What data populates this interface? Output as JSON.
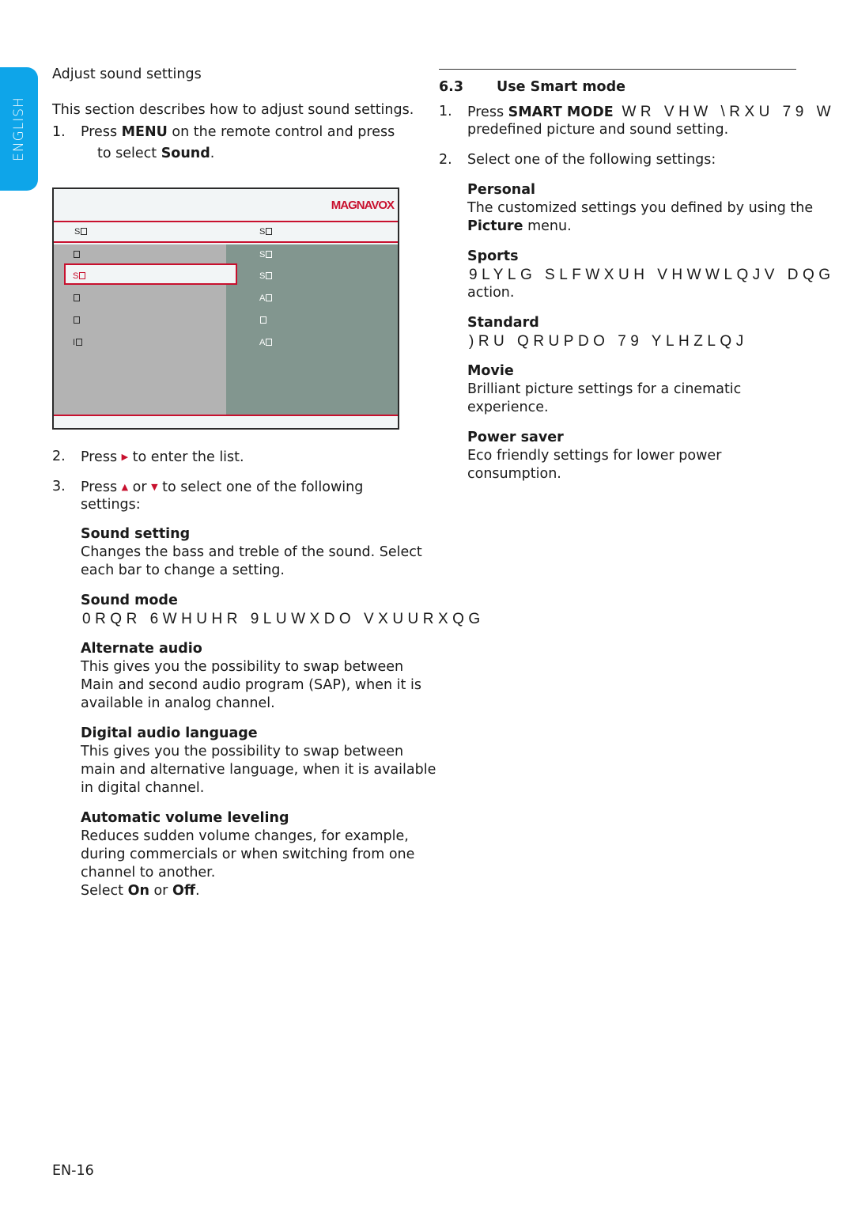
{
  "side_tab": {
    "label": "ENGLISH",
    "color": "#0ea5e9"
  },
  "left": {
    "heading": "Adjust sound settings",
    "intro": "This section describes how to adjust sound settings.",
    "step1": {
      "num": "1.",
      "pre": "Press ",
      "key": "MENU",
      "post": " on the remote control and press",
      "line2_pre": "to select ",
      "line2_key": "Sound",
      "line2_post": "."
    },
    "menu": {
      "brand": "MAGNAVOX",
      "brand_color": "#c8102e",
      "header_left": "S",
      "header_right": "S",
      "left_items": [
        "",
        "S",
        "",
        "",
        "I"
      ],
      "selected_index": 1,
      "right_items": [
        "S",
        "S",
        "A",
        "",
        "A"
      ]
    },
    "step2": {
      "num": "2.",
      "pre": "Press ",
      "arrow": "▶",
      "post": " to enter the list."
    },
    "step3": {
      "num": "3.",
      "pre": "Press ",
      "arrow_up": "▲",
      "mid": " or ",
      "arrow_down": "▼",
      "post": " to select one of the following",
      "line2": "settings:"
    },
    "options": [
      {
        "title": "Sound setting",
        "lines": [
          "Changes the bass and treble of the sound. Select",
          "each bar to change a setting."
        ]
      },
      {
        "title": "Sound mode",
        "lines": [
          "0RQR  6WHUHR  9LUWXDO  VXUURXQG"
        ],
        "encoded": true
      },
      {
        "title": "Alternate audio",
        "lines": [
          "This gives you the possibility to swap between",
          "Main and second audio program (SAP), when it is",
          "available in analog channel."
        ]
      },
      {
        "title": "Digital audio language",
        "lines": [
          "This gives you the possibility to swap between",
          "main and alternative language, when it is available",
          "in digital channel."
        ]
      },
      {
        "title": "Automatic volume leveling",
        "lines": [
          "Reduces sudden volume changes, for example,",
          "during commercials or when switching from one",
          "channel to another."
        ],
        "select_pre": "Select ",
        "select_on": "On",
        "select_mid": " or ",
        "select_off": "Off",
        "select_post": "."
      }
    ]
  },
  "right": {
    "section_num": "6.3",
    "section_title": "Use Smart mode",
    "step1": {
      "num": "1.",
      "pre": "Press ",
      "key": "SMART MODE",
      "encoded": " WR  VHW  \\RXU 79  W",
      "line2": "predefined picture and sound setting."
    },
    "step2": {
      "num": "2.",
      "text": "Select one of the following settings:"
    },
    "modes": [
      {
        "title": "Personal",
        "lines": [
          "The customized settings you defined by using the"
        ],
        "line2_bold": "Picture",
        "line2_rest": " menu."
      },
      {
        "title": "Sports",
        "lines": [
          "9LYLG  SLFWXUH  VHWWLQJV  DQG"
        ],
        "encoded": true,
        "extra": "action."
      },
      {
        "title": "Standard",
        "lines": [
          ")RU  QRUPDO 79  YLHZLQJ"
        ],
        "encoded": true
      },
      {
        "title": "Movie",
        "lines": [
          "Brilliant picture settings for a cinematic",
          "experience."
        ]
      },
      {
        "title": "Power saver",
        "lines": [
          "Eco friendly settings for lower power",
          "consumption."
        ]
      }
    ]
  },
  "footer": {
    "page_number": "EN-16"
  }
}
